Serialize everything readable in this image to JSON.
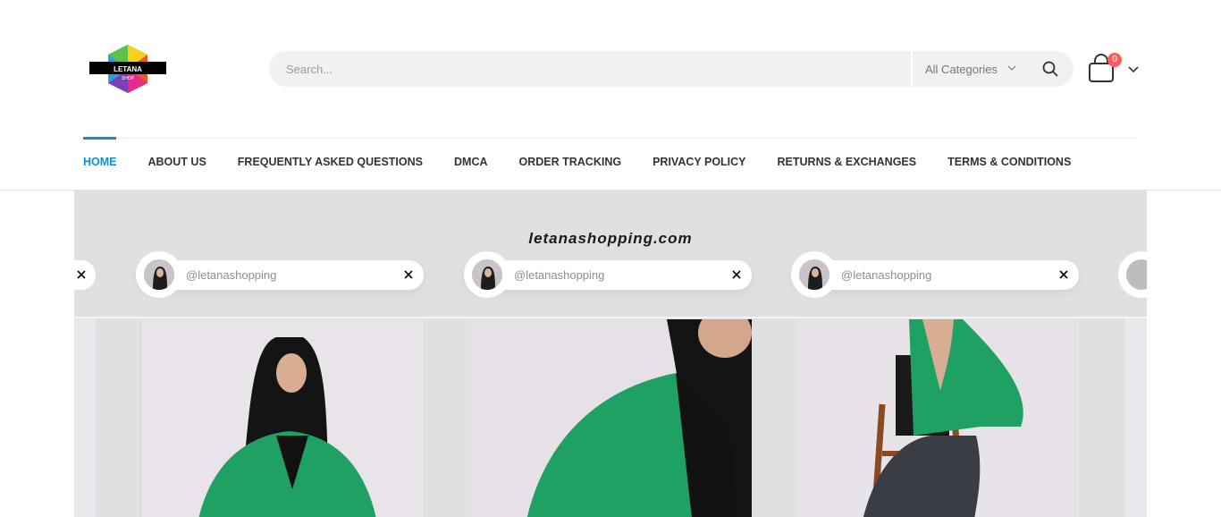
{
  "brand": {
    "logo_text": "LETANA",
    "logo_subtext": "SHOP"
  },
  "search": {
    "placeholder": "Search...",
    "category_label": "All Categories"
  },
  "cart": {
    "count": "0"
  },
  "nav": {
    "items": [
      {
        "label": "HOME",
        "active": true
      },
      {
        "label": "ABOUT US"
      },
      {
        "label": "FREQUENTLY ASKED QUESTIONS"
      },
      {
        "label": "DMCA"
      },
      {
        "label": "ORDER TRACKING"
      },
      {
        "label": "PRIVACY POLICY"
      },
      {
        "label": "RETURNS & EXCHANGES"
      },
      {
        "label": "TERMS & CONDITIONS"
      }
    ]
  },
  "hero": {
    "title": "letanashopping.com",
    "cards": [
      {
        "handle": "@letanashopping"
      },
      {
        "handle": "@letanashopping"
      },
      {
        "handle": "@letanashopping"
      }
    ]
  },
  "colors": {
    "accent": "#0c8fd5",
    "badge": "#ff5b5b",
    "jacket": "#1fa163",
    "hero_bg": "#e0e0e2"
  }
}
